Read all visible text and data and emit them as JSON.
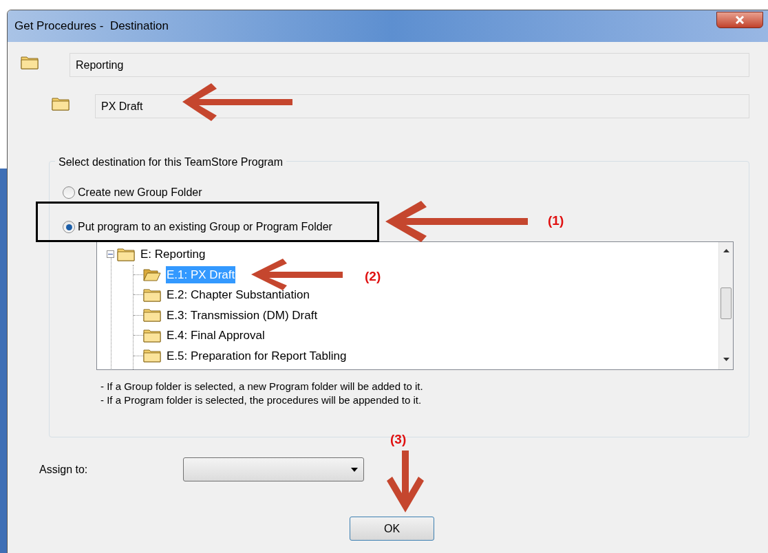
{
  "window": {
    "title": "Get Procedures -  Destination"
  },
  "path_fields": [
    {
      "value": "Reporting"
    },
    {
      "value": "PX Draft"
    }
  ],
  "destination_group": {
    "legend": "Select destination for this TeamStore Program",
    "options": [
      {
        "label": "Create new Group Folder",
        "selected": false
      },
      {
        "label": "Put program to an existing Group or Program Folder",
        "selected": true
      }
    ],
    "tree": [
      {
        "label": "E: Reporting",
        "expanded": true,
        "selected": false,
        "children": [
          {
            "label": "E.1: PX Draft",
            "selected": true
          },
          {
            "label": "E.2: Chapter Substantiation",
            "selected": false
          },
          {
            "label": "E.3: Transmission (DM) Draft",
            "selected": false
          },
          {
            "label": "E.4: Final Approval",
            "selected": false
          },
          {
            "label": "E.5: Preparation for Report Tabling",
            "selected": false
          }
        ]
      }
    ],
    "notes": [
      "- If a Group folder is selected, a new Program folder will be added to it.",
      "- If a Program folder is selected, the procedures will be appended to it."
    ]
  },
  "assign_to": {
    "label": "Assign to:"
  },
  "ok_button": {
    "label": "OK"
  },
  "annotations": [
    {
      "label": "(1)"
    },
    {
      "label": "(2)"
    },
    {
      "label": "(3)"
    }
  ]
}
